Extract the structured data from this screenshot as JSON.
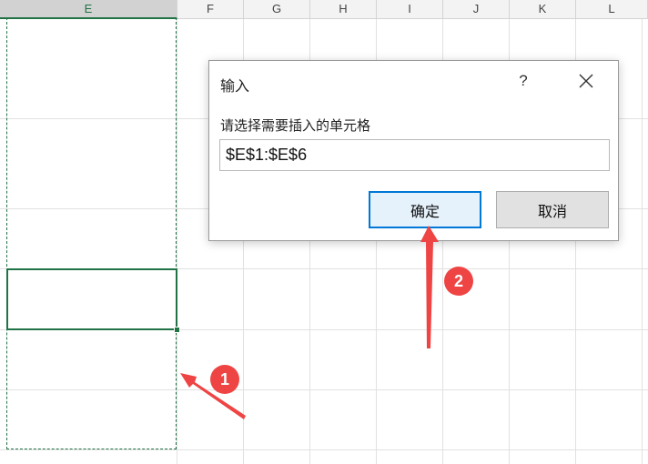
{
  "sheet": {
    "columns": [
      "E",
      "F",
      "G",
      "H",
      "I",
      "J",
      "K",
      "L"
    ],
    "selected_column": "E"
  },
  "dialog": {
    "title": "输入",
    "help_label": "?",
    "prompt": "请选择需要插入的单元格",
    "range_value": "$E$1:$E$6",
    "ok_label": "确定",
    "cancel_label": "取消"
  },
  "annotations": {
    "step1": "1",
    "step2": "2",
    "color": "#ef4444"
  },
  "colors": {
    "excel_green": "#217346",
    "focus_blue": "#0078d7"
  }
}
